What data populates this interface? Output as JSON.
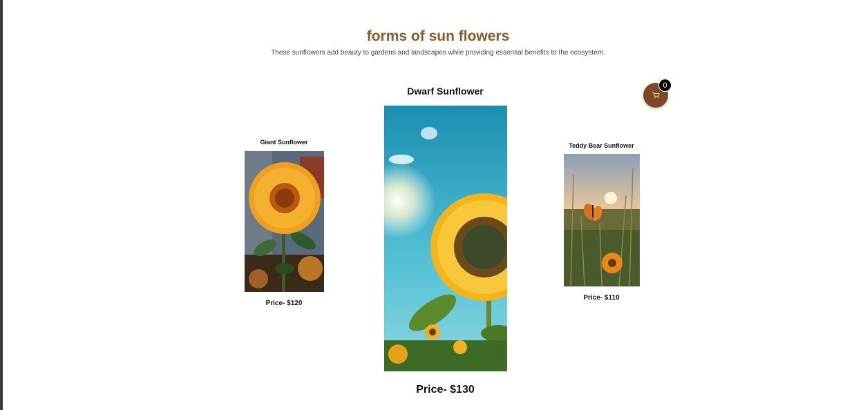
{
  "header": {
    "title": "forms of sun flowers",
    "subtitle": "These sunflowers add beauty to gardens and landscapes while providing essential benefits to the ecosystem."
  },
  "products": [
    {
      "name": "Giant Sunflower",
      "price": "Price- $120",
      "image": "giant-sunflower-photo"
    },
    {
      "name": "Dwarf Sunflower",
      "price": "Price- $130",
      "image": "dwarf-sunflower-photo"
    },
    {
      "name": "Teddy Bear Sunflower",
      "price": "Price- $110",
      "image": "teddy-bear-sunflower-photo"
    }
  ],
  "cart": {
    "count": "0",
    "icon": "cart-icon"
  },
  "colors": {
    "title": "#8a5a2b",
    "cart_button": "#7a4a24",
    "badge": "#000000"
  }
}
